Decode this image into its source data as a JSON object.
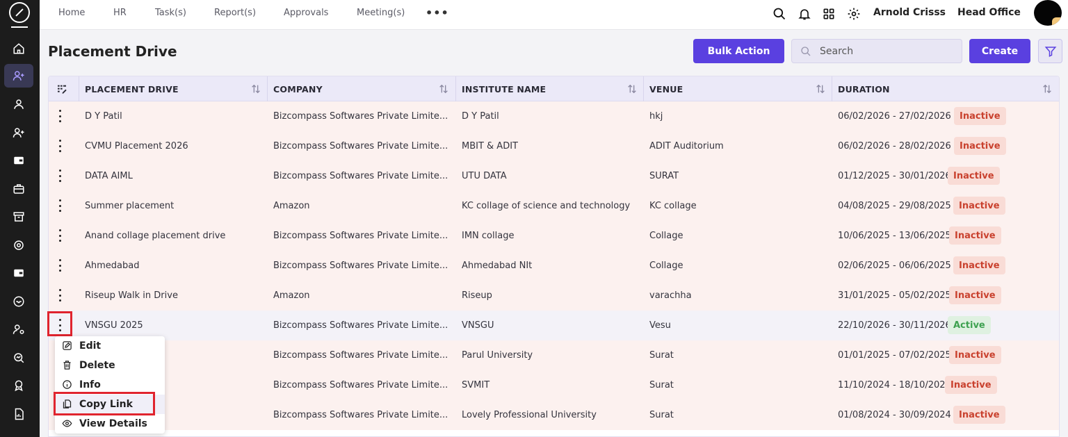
{
  "nav": {
    "items": [
      "Home",
      "HR",
      "Task(s)",
      "Report(s)",
      "Approvals",
      "Meeting(s)"
    ],
    "more": "•••",
    "user_name": "Arnold Crisss",
    "office": "Head Office"
  },
  "page": {
    "title": "Placement Drive",
    "bulk_action": "Bulk Action",
    "search_placeholder": "Search",
    "create": "Create"
  },
  "table": {
    "columns": [
      "PLACEMENT DRIVE",
      "COMPANY",
      "INSTITUTE NAME",
      "VENUE",
      "DURATION"
    ],
    "rows": [
      {
        "drive": "D Y Patil",
        "company": "Bizcompass Softwares Private Limite...",
        "institute": "D Y Patil",
        "venue": "hkj",
        "duration": "06/02/2026 - 27/02/2026",
        "status": "Inactive"
      },
      {
        "drive": "CVMU Placement 2026",
        "company": "Bizcompass Softwares Private Limite...",
        "institute": "MBIT & ADIT",
        "venue": "ADIT Auditorium",
        "duration": "06/02/2026 - 28/02/2026",
        "status": "Inactive"
      },
      {
        "drive": "DATA AIML",
        "company": "Bizcompass Softwares Private Limite...",
        "institute": "UTU DATA",
        "venue": "SURAT",
        "duration": "01/12/2025 - 30/01/2026",
        "status": "Inactive"
      },
      {
        "drive": "Summer placement",
        "company": "Amazon",
        "institute": "KC collage of science and technology",
        "venue": "KC collage",
        "duration": "04/08/2025 - 29/08/2025",
        "status": "Inactive"
      },
      {
        "drive": "Anand collage placement drive",
        "company": "Bizcompass Softwares Private Limite...",
        "institute": "IMN collage",
        "venue": "Collage",
        "duration": "10/06/2025 - 13/06/2025",
        "status": "Inactive"
      },
      {
        "drive": "Ahmedabad",
        "company": "Bizcompass Softwares Private Limite...",
        "institute": "Ahmedabad NIt",
        "venue": "Collage",
        "duration": "02/06/2025 - 06/06/2025",
        "status": "Inactive"
      },
      {
        "drive": "Riseup Walk in Drive",
        "company": "Amazon",
        "institute": "Riseup",
        "venue": "varachha",
        "duration": "31/01/2025 - 05/02/2025",
        "status": "Inactive"
      },
      {
        "drive": "VNSGU 2025",
        "company": "Bizcompass Softwares Private Limite...",
        "institute": "VNSGU",
        "venue": "Vesu",
        "duration": "22/10/2026 - 30/11/2026",
        "status": "Active"
      },
      {
        "drive": "",
        "company": "Bizcompass Softwares Private Limite...",
        "institute": "Parul University",
        "venue": "Surat",
        "duration": "01/01/2025 - 07/02/2025",
        "status": "Inactive"
      },
      {
        "drive": "",
        "company": "Bizcompass Softwares Private Limite...",
        "institute": "SVMIT",
        "venue": "Surat",
        "duration": "11/10/2024 - 18/10/2024",
        "status": "Inactive"
      },
      {
        "drive": "",
        "company": "Bizcompass Softwares Private Limite...",
        "institute": "Lovely Professional University",
        "venue": "Surat",
        "duration": "01/08/2024 - 30/09/2024",
        "status": "Inactive"
      }
    ]
  },
  "context_menu": {
    "items": [
      "Edit",
      "Delete",
      "Info",
      "Copy Link",
      "View Details"
    ]
  },
  "colors": {
    "primary": "#5a40e0",
    "sidebar": "#1c1c1c",
    "inactive": "#c9412e",
    "active": "#3ea150",
    "highlight": "#e0242e"
  }
}
